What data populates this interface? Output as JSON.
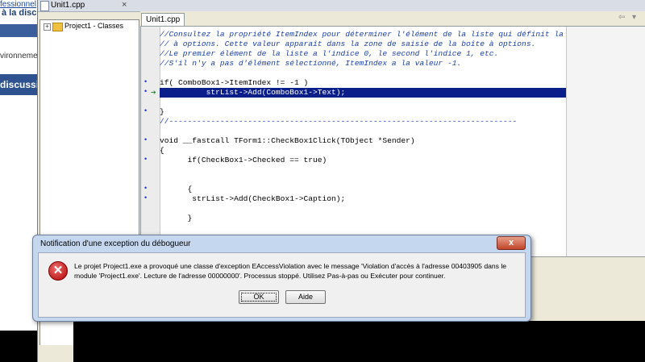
{
  "browser": {
    "link_text": "fessionnel",
    "heading": "à la disc",
    "sidebar_text": "vironneme",
    "section_banner": "discussi"
  },
  "ide": {
    "window_title": "Unit1.cpp",
    "window_close": "×",
    "editor_tab": "Unit1.cpp",
    "nav_back": "⇦",
    "nav_forward": "▾",
    "project_tree": {
      "expander": "+",
      "root_label": "Project1 - Classes"
    },
    "code_lines": [
      "//Consultez la propriété ItemIndex pour déterminer l'élément de la liste qui définit la valeur de la boît",
      "// à options. Cette valeur apparaît dans la zone de saisie de la boîte à options.",
      "//Le premier élément de la liste a l'indice 0, le second l'indice 1, etc.",
      "//S'il n'y a pas d'élément sélectionné, ItemIndex a la valeur -1.",
      "",
      "if( ComboBox1->ItemIndex != -1 )",
      "          strList->Add(ComboBox1->Text);",
      "",
      "}",
      "//---------------------------------------------------------------------------",
      "",
      "void __fastcall TForm1::CheckBox1Click(TObject *Sender)",
      "{",
      "      if(CheckBox1->Checked == true)",
      "",
      "",
      "      {",
      "       strList->Add(CheckBox1->Caption);",
      "",
      "      }"
    ]
  },
  "dialog": {
    "title": "Notification d'une exception du débogueur",
    "close_label": "x",
    "icon_glyph": "✕",
    "message": "Le projet Project1.exe a provoqué une classe d'exception EAccessViolation avec le message 'Violation d'accès à l'adresse 00403905 dans le module 'Project1.exe'. Lecture de l'adresse 00000000'.  Processus stoppé. Utilisez Pas-à-pas ou Exécuter pour continuer.",
    "ok_label": "OK",
    "help_label": "Aide"
  },
  "colors": {
    "highlight": "#0a1f8a",
    "comment": "#1a3fa8",
    "dialog_frame": "#c4d7ef",
    "close_button": "#c0442a"
  }
}
